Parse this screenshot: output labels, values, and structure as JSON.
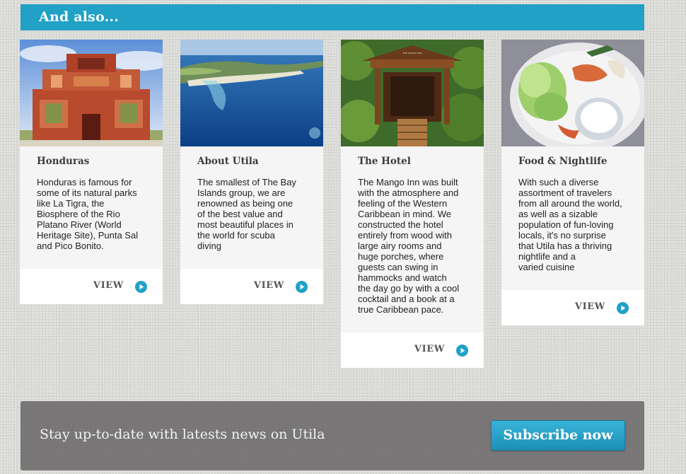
{
  "section": {
    "title": "And also..."
  },
  "cards": [
    {
      "title": "Honduras",
      "lines": [
        "Honduras is famous for",
        "some of its natural parks",
        "like La Tigra, the",
        "Biosphere of the Rio",
        "Platano River (World",
        "Heritage Site), Punta Sal",
        "and Pico Bonito."
      ],
      "view_label": "VIEW",
      "image_label": "Copan Mayan ruins temple photo"
    },
    {
      "title": "About Utila",
      "lines": [
        "The smallest of The Bay",
        "Islands group, we are",
        "renowned as being one",
        "of the best value and",
        "most beautiful places in",
        "the world for scuba",
        "diving"
      ],
      "view_label": "VIEW",
      "image_label": "Aerial view of Utila island"
    },
    {
      "title": "The Hotel",
      "lines": [
        "The Mango Inn was built",
        "with the atmosphere and",
        "feeling of the Western",
        "Caribbean in mind. We",
        "constructed the hotel",
        "entirely from wood with",
        "large airy rooms and",
        "huge porches, where",
        "guests can swing in",
        "hammocks and watch",
        "the day go by with a cool",
        "cocktail and a book at a",
        "true Caribbean pace."
      ],
      "view_label": "VIEW",
      "image_sign": "THE MANGO INN",
      "image_label": "Mango Inn wooden entrance"
    },
    {
      "title": "Food & Nightlife",
      "lines": [
        "With such a diverse",
        "assortment of travelers",
        "from all around the world,",
        "as well as a sizable",
        "population of fun-loving",
        "locals, it's no surprise",
        "that Utila has a thriving",
        "nightlife and a",
        "varied cuisine"
      ],
      "view_label": "VIEW",
      "image_label": "Plate of salad and dip"
    }
  ],
  "newsletter": {
    "text": "Stay up-to-date with latests news on Utila",
    "button_label": "Subscribe now"
  },
  "colors": {
    "accent": "#21a1c6",
    "banner_bg": "#7a7878",
    "page_bg": "#d9d9d6"
  },
  "icons": {
    "view": "play-circle-icon"
  }
}
